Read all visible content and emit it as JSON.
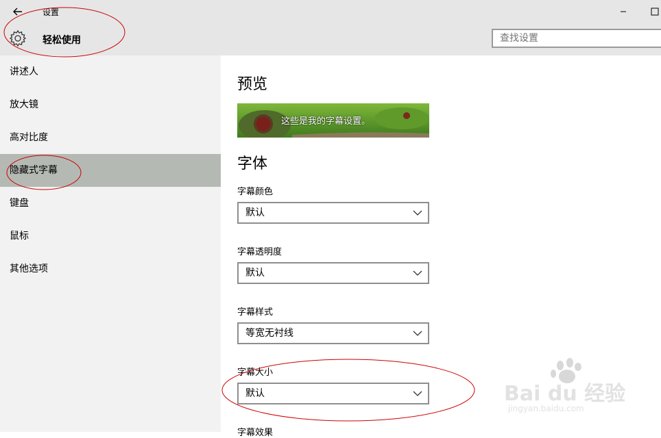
{
  "window": {
    "title": "设置"
  },
  "header": {
    "title": "轻松使用",
    "search_placeholder": "查找设置"
  },
  "sidebar": {
    "items": [
      {
        "label": "讲述人"
      },
      {
        "label": "放大镜"
      },
      {
        "label": "高对比度"
      },
      {
        "label": "隐藏式字幕"
      },
      {
        "label": "键盘"
      },
      {
        "label": "鼠标"
      },
      {
        "label": "其他选项"
      }
    ]
  },
  "content": {
    "preview_title": "预览",
    "preview_text": "这些是我的字幕设置。",
    "font_title": "字体",
    "fields": [
      {
        "label": "字幕颜色",
        "value": "默认"
      },
      {
        "label": "字幕透明度",
        "value": "默认"
      },
      {
        "label": "字幕样式",
        "value": "等宽无衬线"
      },
      {
        "label": "字幕大小",
        "value": "默认"
      },
      {
        "label": "字幕效果"
      }
    ]
  },
  "watermark": {
    "brand": "Bai du 经验",
    "url": "jingyan.baidu.com"
  },
  "colors": {
    "accent_selected": "#b5b9b4",
    "annotation": "#cc0000"
  }
}
